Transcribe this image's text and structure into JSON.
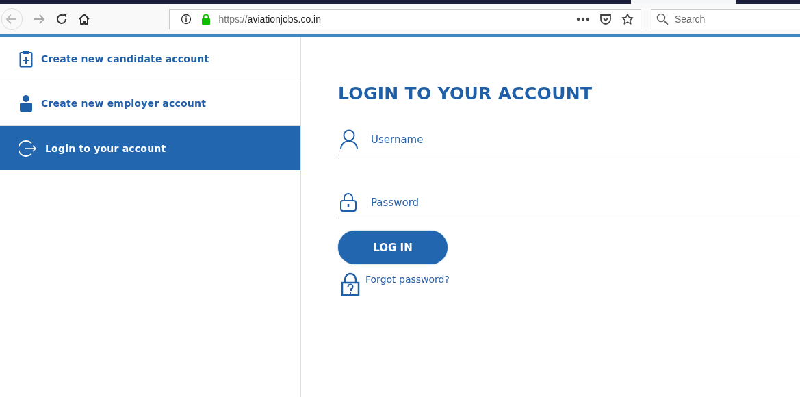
{
  "browser": {
    "url_scheme": "https://",
    "url_host": "aviationjobs.co.in",
    "search": {
      "placeholder": "Search"
    }
  },
  "sidebar": {
    "items": [
      {
        "label": "Create new candidate account",
        "kind": "candidate",
        "selected": false
      },
      {
        "label": "Create new employer account",
        "kind": "employer",
        "selected": false
      },
      {
        "label": "Login to your account",
        "kind": "login",
        "selected": true
      }
    ]
  },
  "login": {
    "title": "LOGIN TO YOUR ACCOUNT",
    "fields": [
      {
        "kind": "username",
        "placeholder": "Username"
      },
      {
        "kind": "password",
        "placeholder": "Password"
      }
    ],
    "button": "LOG IN",
    "forgot_link": "Forgot password?"
  }
}
